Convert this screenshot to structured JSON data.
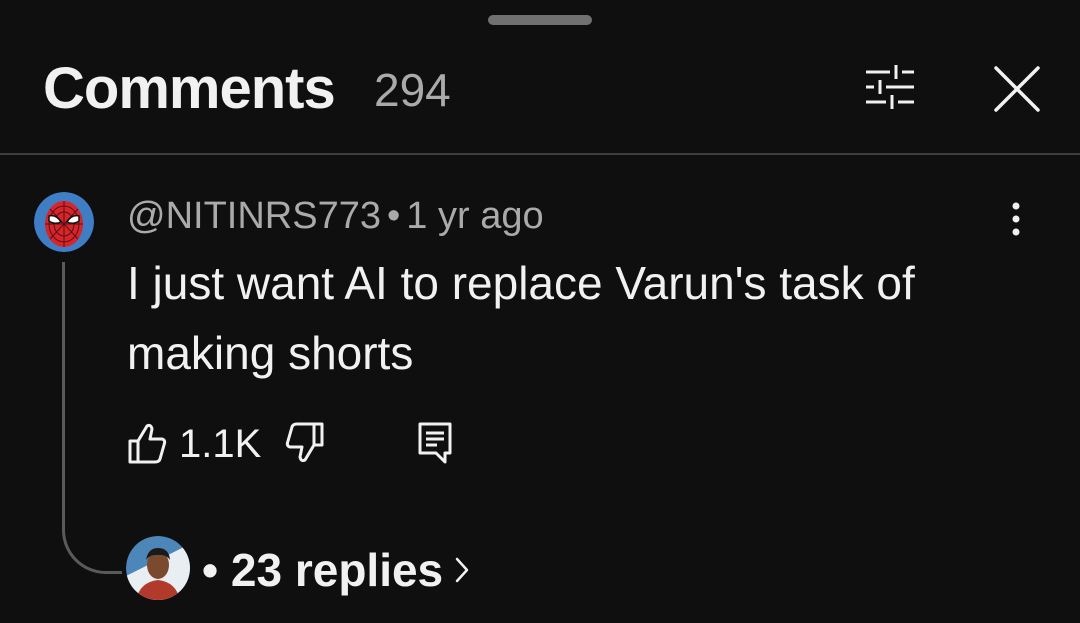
{
  "header": {
    "title": "Comments",
    "count": "294"
  },
  "comment": {
    "author": "@NITINRS773",
    "separator": "•",
    "timestamp": "1 yr ago",
    "text": "I just want AI to replace Varun's task of making shorts",
    "likes": "1.1K",
    "replies_label": "• 23 replies"
  },
  "icons": {
    "filter": "filter-sliders-icon",
    "close": "close-icon",
    "more": "more-vert-icon",
    "like": "thumbs-up-icon",
    "dislike": "thumbs-down-icon",
    "reply": "reply-icon",
    "chevron": "chevron-right-icon"
  },
  "colors": {
    "background": "#0f0f0f",
    "text_primary": "#f1f1f1",
    "text_secondary": "#aaaaaa",
    "divider": "#3d3d3d"
  }
}
